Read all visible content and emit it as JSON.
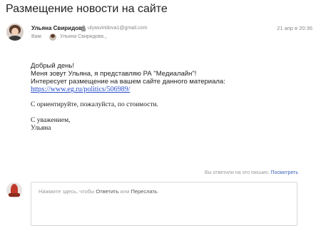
{
  "subject": "Размещение новости на сайте",
  "sender": {
    "name": "Ульяна Свиридова",
    "email": "ulyasviridova1@gmail.com",
    "date": "21 апр в 20:36"
  },
  "recipient": {
    "label": "Вам:",
    "name": "Ульяна Свиридова"
  },
  "body": {
    "greeting": "Добрый день!",
    "intro": "Меня зовут Ульяна, я представляю РА \"Медиалайн\"!",
    "interest": "Интересует размещение на вашем сайте данного материала:",
    "link": "https://www.eg.ru/politics/506989/",
    "request": "С ориентируйте, пожалуйста, по стоимости.",
    "closing": "С уважением,",
    "signature": "Ульяна"
  },
  "replied_notice": {
    "text": "Вы ответили на это письмо:",
    "action": "Посмотреть"
  },
  "reply": {
    "prefix": "Нажмите здесь, чтобы",
    "reply_action": "Ответить",
    "or": "или",
    "forward_action": "Переслать"
  },
  "icons": {
    "lock": "lock-icon",
    "chevron": "chevron-down-icon"
  }
}
